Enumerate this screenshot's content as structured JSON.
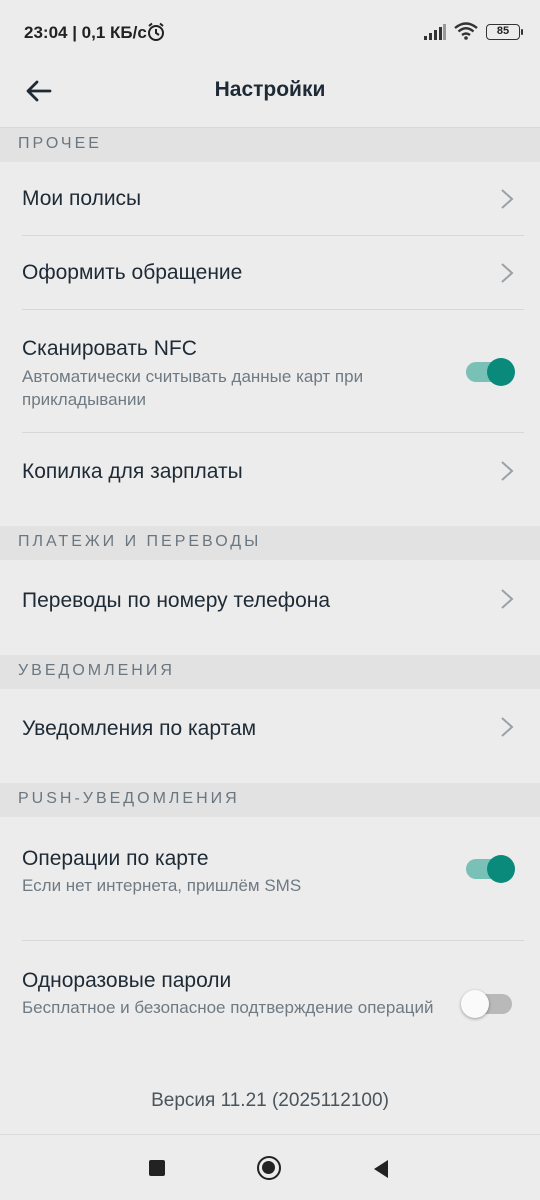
{
  "status_bar": {
    "time": "23:04 | 0,1 КБ/с",
    "battery": "85",
    "icons": [
      "alarm-icon",
      "signal-icon",
      "wifi-icon",
      "battery-icon"
    ]
  },
  "header": {
    "title": "Настройки",
    "back_icon": "arrow-left-icon"
  },
  "sections": {
    "other": "ПРОЧЕЕ",
    "payments": "ПЛАТЕЖИ И ПЕРЕВОДЫ",
    "notifications": "УВЕДОМЛЕНИЯ",
    "push": "PUSH-УВЕДОМЛЕНИЯ"
  },
  "items": {
    "policies": {
      "label": "Мои полисы"
    },
    "appeal": {
      "label": "Оформить обращение"
    },
    "nfc": {
      "label": "Сканировать NFC",
      "sub": "Автоматически считывать данные карт при прикладывании",
      "enabled": true
    },
    "piggy": {
      "label": "Копилка для зарплаты"
    },
    "phone_transfers": {
      "label": "Переводы по номеру телефона"
    },
    "card_notifications": {
      "label": "Уведомления по картам"
    },
    "card_operations": {
      "label": "Операции по карте",
      "sub": "Если нет интернета, пришлём SMS",
      "enabled": true
    },
    "otp": {
      "label": "Одноразовые пароли",
      "sub": "Бесплатное и безопасное подтверждение операций",
      "enabled": false
    }
  },
  "footer": {
    "version": "Версия 11.21 (2025112100)"
  },
  "colors": {
    "accent": "#0a8a7a",
    "accent_track": "#79c0b6",
    "background": "#ececec",
    "section_bg": "#e2e2e2"
  }
}
